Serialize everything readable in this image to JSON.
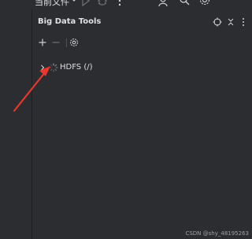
{
  "topbar": {
    "run_config_label": "当前文件",
    "icons": [
      "chevron-down-icon",
      "run-icon",
      "debug-icon",
      "more-icon",
      "add-user-icon",
      "search-icon",
      "settings-icon",
      "minimize-icon"
    ]
  },
  "panel": {
    "title": "Big Data Tools",
    "header_icons": [
      "target-icon",
      "collapse-icon",
      "more-icon"
    ],
    "toolbar": {
      "add_label": "+",
      "remove_label": "−",
      "icons": [
        "plus-icon",
        "minus-icon",
        "settings-icon"
      ]
    }
  },
  "tree": {
    "items": [
      {
        "label": "HDFS (/)",
        "icon": "loading-spinner-icon",
        "expanded": false
      }
    ]
  },
  "annotation": {
    "type": "red-arrow",
    "color": "#e8372b"
  },
  "watermark": "CSDN @shy_48195263",
  "colors": {
    "background": "#2b2d30",
    "divider": "#1e1f22",
    "text": "#dfe1e5",
    "icon": "#ced0d6",
    "arrow": "#e8372b"
  }
}
